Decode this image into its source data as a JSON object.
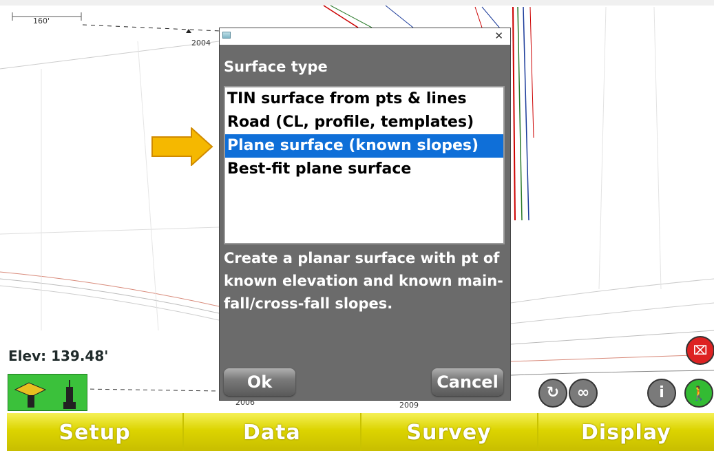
{
  "map": {
    "scale_label": "160'",
    "point_labels": [
      "2004",
      "2006",
      "2009"
    ],
    "elevation": "Elev: 139.48'"
  },
  "dialog": {
    "heading": "Surface type",
    "close_icon": "close-icon",
    "items": [
      {
        "label": "TIN surface from pts & lines",
        "selected": false
      },
      {
        "label": "Road (CL, profile, templates)",
        "selected": false
      },
      {
        "label": "Plane surface (known slopes)",
        "selected": true
      },
      {
        "label": "Best-fit plane surface",
        "selected": false
      }
    ],
    "description": "Create a planar surface with pt of known elevation and known main-fall/cross-fall slopes.",
    "ok_label": "Ok",
    "cancel_label": "Cancel"
  },
  "toolbar": {
    "icons": [
      "rover-icon",
      "antenna-icon",
      "rotate-icon",
      "infinity-icon",
      "info-icon",
      "walk-icon",
      "stakeout-icon"
    ]
  },
  "nav": {
    "items": [
      "Setup",
      "Data",
      "Survey",
      "Display"
    ]
  },
  "colors": {
    "selection": "#0f6fd8",
    "dialog_bg": "#6b6b6b",
    "nav_yellow": "#dcd400",
    "arrow": "#f5b800"
  }
}
